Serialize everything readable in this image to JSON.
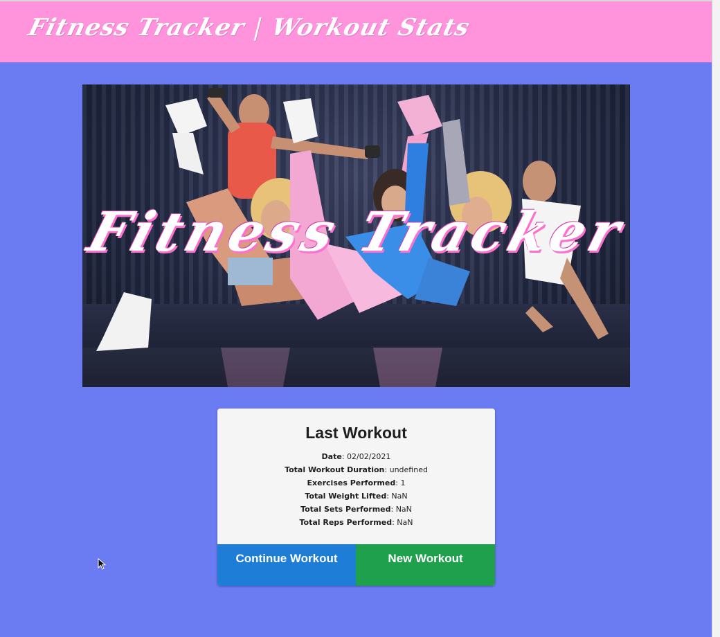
{
  "navbar": {
    "brand_left": "Fitness Tracker",
    "separator": "|",
    "brand_right": "Workout Stats"
  },
  "hero": {
    "title": "Fitness Tracker"
  },
  "last_workout": {
    "title": "Last Workout",
    "stats": [
      {
        "label": "Date",
        "value": "02/02/2021"
      },
      {
        "label": "Total Workout Duration",
        "value": "undefined"
      },
      {
        "label": "Exercises Performed",
        "value": "1"
      },
      {
        "label": "Total Weight Lifted",
        "value": "NaN"
      },
      {
        "label": "Total Sets Performed",
        "value": "NaN"
      },
      {
        "label": "Total Reps Performed",
        "value": "NaN"
      }
    ],
    "continue_label": "Continue Workout",
    "new_label": "New Workout"
  },
  "colors": {
    "page_bg": "#6b7cf2",
    "navbar_bg": "#ff94dd",
    "continue_btn": "#1e7dd6",
    "new_btn": "#1fa04d"
  },
  "icons": {
    "cursor": "mouse-pointer-icon"
  }
}
